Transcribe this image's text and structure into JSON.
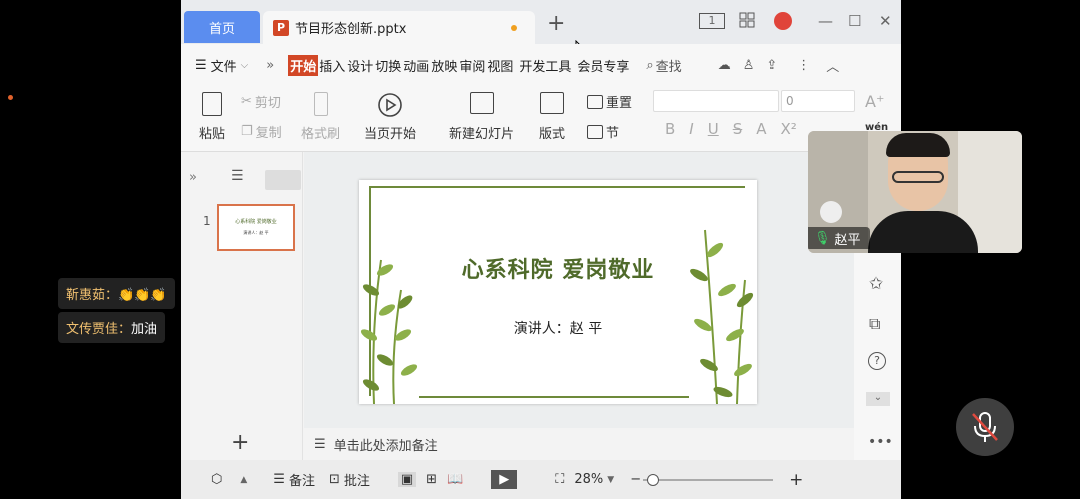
{
  "tabs": {
    "home": "首页",
    "document": "节目形态创新.pptx",
    "add": "+"
  },
  "window": {
    "reading_mode_label": "1"
  },
  "menu": {
    "file": "文件",
    "more": "»",
    "tabs": [
      "开始",
      "插入",
      "设计",
      "切换",
      "动画",
      "放映",
      "审阅",
      "视图",
      "开发工具",
      "会员专享"
    ],
    "search": "查找"
  },
  "ribbon": {
    "paste": "粘贴",
    "cut": "剪切",
    "copy": "复制",
    "format_painter": "格式刷",
    "from_current": "当页开始",
    "new_slide": "新建幻灯片",
    "layout": "版式",
    "reset": "重置",
    "section": "节",
    "font_size": "0",
    "text_effect": "wén"
  },
  "slides_panel": {
    "more": "»",
    "slide_number": "1"
  },
  "slide": {
    "title": "心系科院  爱岗敬业",
    "subtitle": "演讲人：赵  平",
    "thumb_title": "心系科院 爱岗敬业",
    "thumb_sub": "演讲人：赵 平"
  },
  "notes": {
    "placeholder": "单击此处添加备注"
  },
  "statusbar": {
    "notes": "备注",
    "comment": "批注",
    "zoom": "28%",
    "plus": "+"
  },
  "video": {
    "participant_name": "赵平"
  },
  "chat": [
    {
      "name": "靳惠茹：",
      "message": "👏👏👏"
    },
    {
      "name": "文传贾佳：",
      "message": "加油"
    }
  ],
  "colors": {
    "accent": "#5b8def",
    "ppt_red": "#d24726",
    "slide_green": "#4f6a2a"
  }
}
